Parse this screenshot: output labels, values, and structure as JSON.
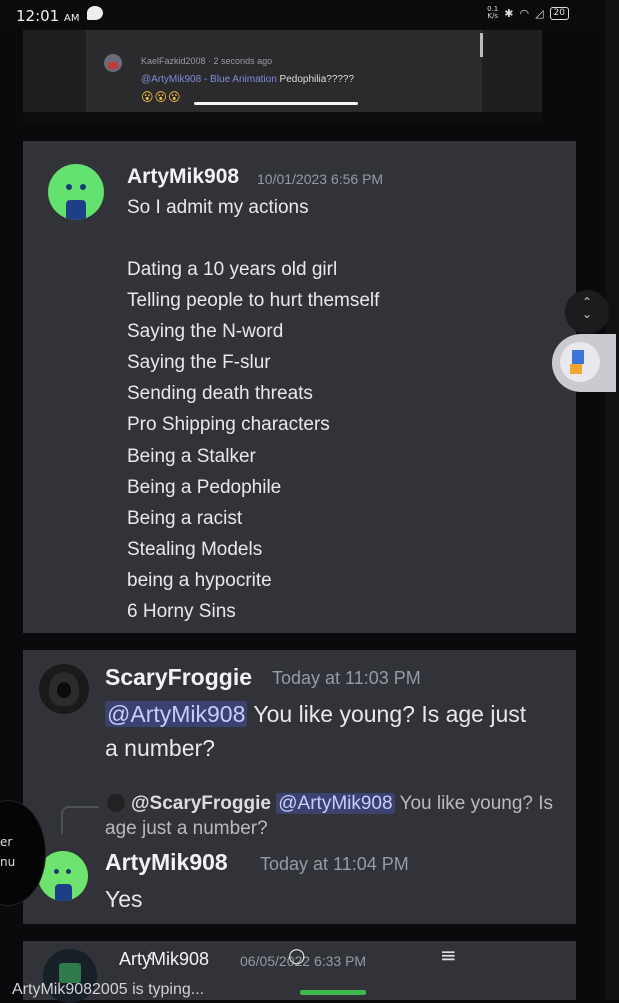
{
  "status_bar": {
    "time": "12:01",
    "ampm": "AM",
    "net_speed_top": "0.1",
    "net_speed_bottom": "K/s",
    "battery": "20"
  },
  "top_preview": {
    "username": "KaelFazkid2008 · 2 seconds ago",
    "reply_mention": "@ArtyMik908 - Blue Animation",
    "reply_text": "Pedophilia?????",
    "emojis": "😮😮😮"
  },
  "message1": {
    "username": "ArtyMik908",
    "timestamp": "10/01/2023 6:56 PM",
    "lines": [
      "So I admit my actions",
      "",
      "Dating a 10 years old girl",
      "Telling people to hurt themself",
      "Saying the N-word",
      "Saying the F-slur",
      "Sending death threats",
      "Pro Shipping characters",
      "Being a Stalker",
      "Being a Pedophile",
      "Being a racist",
      "Stealing Models",
      "being a hypocrite",
      "6 Horny Sins"
    ]
  },
  "message2": {
    "username": "ScaryFroggie",
    "timestamp": "Today at 11:03 PM",
    "mention": "@ArtyMik908",
    "text": " You like young? Is age just a number?"
  },
  "reply": {
    "username": "@ScaryFroggie",
    "mention": "@ArtyMik908",
    "text": " You like young? Is age just a number?"
  },
  "message3": {
    "username": "ArtyMik908",
    "timestamp": "Today at 11:04 PM",
    "text": "Yes"
  },
  "message4": {
    "username": "ArtyMik908",
    "timestamp": "06/05/2022 6:33 PM"
  },
  "left_edge": {
    "line1": "er",
    "line2": "nu"
  },
  "typing_indicator": "ArtyMik9082005 is typing...",
  "icons": {
    "back": "‹",
    "home": "○",
    "menu": "≡",
    "scroll": "chevron-up-down-icon"
  }
}
